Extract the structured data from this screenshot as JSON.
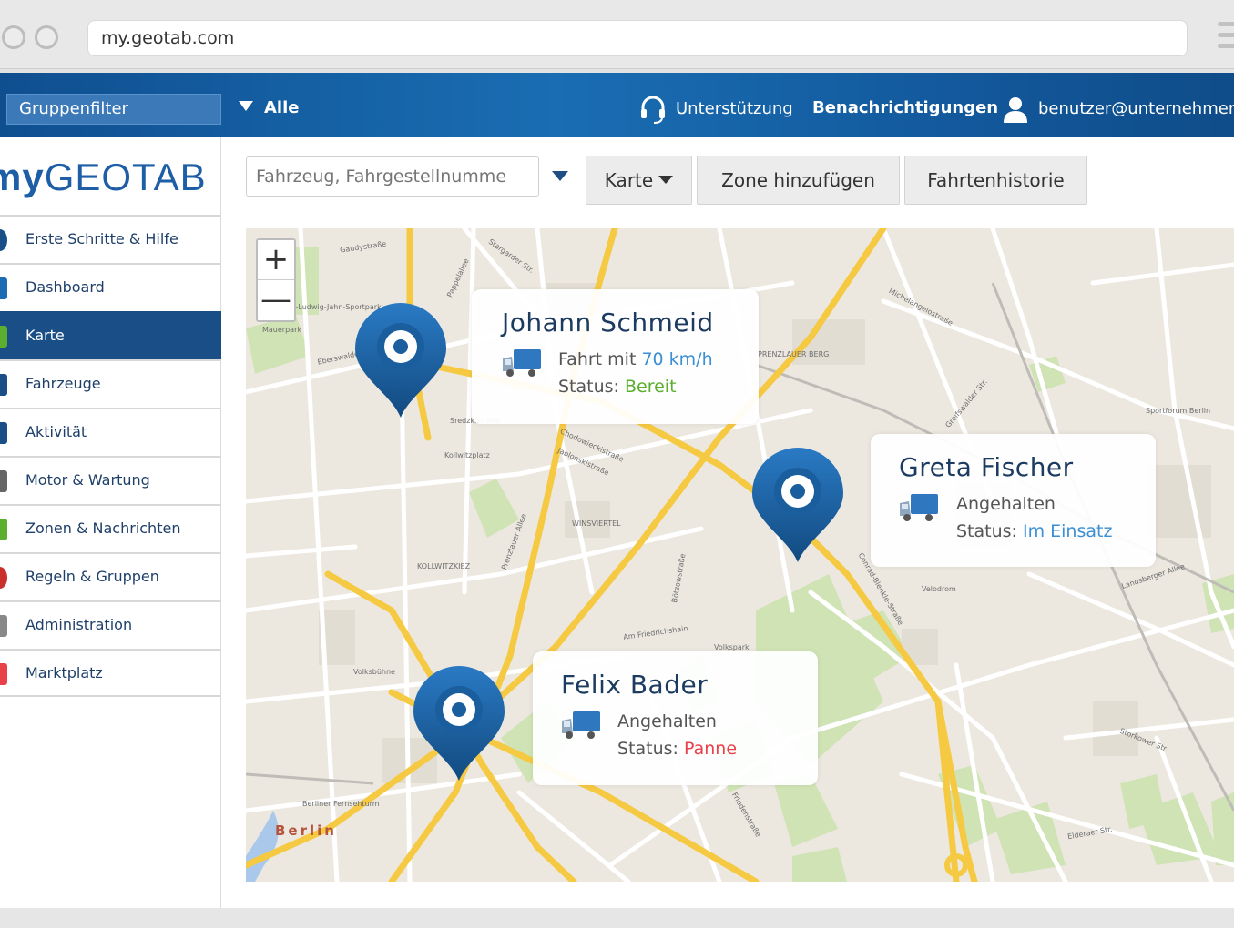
{
  "browser": {
    "url": "my.geotab.com"
  },
  "topbar": {
    "group_filter": "Gruppenfilter",
    "filter_value": "Alle",
    "support": "Unterstützung",
    "notifications": "Benachrichtigungen",
    "user": "benutzer@unternehmen.c"
  },
  "logo": {
    "my": "my",
    "brand": "GEOTAB"
  },
  "sidebar": {
    "items": [
      {
        "label": "Erste Schritte & Hilfe",
        "icon": "help-icon"
      },
      {
        "label": "Dashboard",
        "icon": "dashboard-icon"
      },
      {
        "label": "Karte",
        "icon": "map-icon",
        "active": true
      },
      {
        "label": "Fahrzeuge",
        "icon": "vehicle-icon"
      },
      {
        "label": "Aktivität",
        "icon": "activity-icon"
      },
      {
        "label": "Motor & Wartung",
        "icon": "engine-icon"
      },
      {
        "label": "Zonen & Nachrichten",
        "icon": "zone-icon"
      },
      {
        "label": "Regeln & Gruppen",
        "icon": "rules-icon"
      },
      {
        "label": "Administration",
        "icon": "gear-icon"
      },
      {
        "label": "Marktplatz",
        "icon": "marketplace-icon"
      }
    ]
  },
  "toolbar": {
    "search_placeholder": "Fahrzeug, Fahrgestellnumme",
    "map_button": "Karte",
    "add_zone_button": "Zone hinzufügen",
    "trip_history_button": "Fahrtenhistorie"
  },
  "map": {
    "zoom_in": "+",
    "zoom_out": "—",
    "labels": {
      "gaudystrasse": "Gaudystraße",
      "stargarder": "Stargarder Str.",
      "pappelallee": "Pappelallee",
      "sportpark": "Friedrich-Ludwig-Jahn-Sportpark",
      "mauerpark": "Mauerpark",
      "eberswalder": "Eberswalder Str.",
      "sredzki": "Sredzkistraße",
      "kollwitzplatz": "Kollwitzplatz",
      "chodowiecki": "Chodowieckistraße",
      "jablonski": "Jablonskistraße",
      "winsviertel": "WINSVIERTEL",
      "kollwitzkiez": "KOLLWITZKIEZ",
      "prenzlauer_allee": "Prenzlauer Allee",
      "prenzlauer_berg": "PRENZLAUER BERG",
      "am_friedrichshain": "Am Friedrichshain",
      "volkspark": "Volkspark",
      "volksbuehne": "Volksbühne",
      "fernsehturm": "Berliner Fernsehturm",
      "berlin": "Berlin",
      "velodrom": "Velodrom",
      "landsberger": "Landsberger Allee",
      "storkower": "Storkower Str.",
      "sportforum": "Sportforum Berlin",
      "michelangelo": "Michelangelostraße",
      "greifswalder": "Greifswalder Str.",
      "conrad": "Conrad-Blenkle-Straße",
      "bötzow": "Bötzowstraße",
      "friedenstrasse": "Friedenstraße",
      "elderaer": "Elderaer Str."
    }
  },
  "vehicles": [
    {
      "name": "Johann Schmeid",
      "line1_prefix": "Fahrt mit ",
      "speed": "70 km/h",
      "status_label": "Status: ",
      "status": "Bereit",
      "status_color": "#5aaf2f"
    },
    {
      "name": "Greta Fischer",
      "line1_prefix": "Angehalten",
      "speed": "",
      "status_label": "Status: ",
      "status": "Im Einsatz",
      "status_color": "#3b8fd4"
    },
    {
      "name": "Felix Bader",
      "line1_prefix": "Angehalten",
      "speed": "",
      "status_label": "Status: ",
      "status": "Panne",
      "status_color": "#e8414a"
    }
  ],
  "colors": {
    "topbar": "#1a6db3",
    "active_nav": "#1a4e86",
    "pin": "#1a5e9e"
  }
}
